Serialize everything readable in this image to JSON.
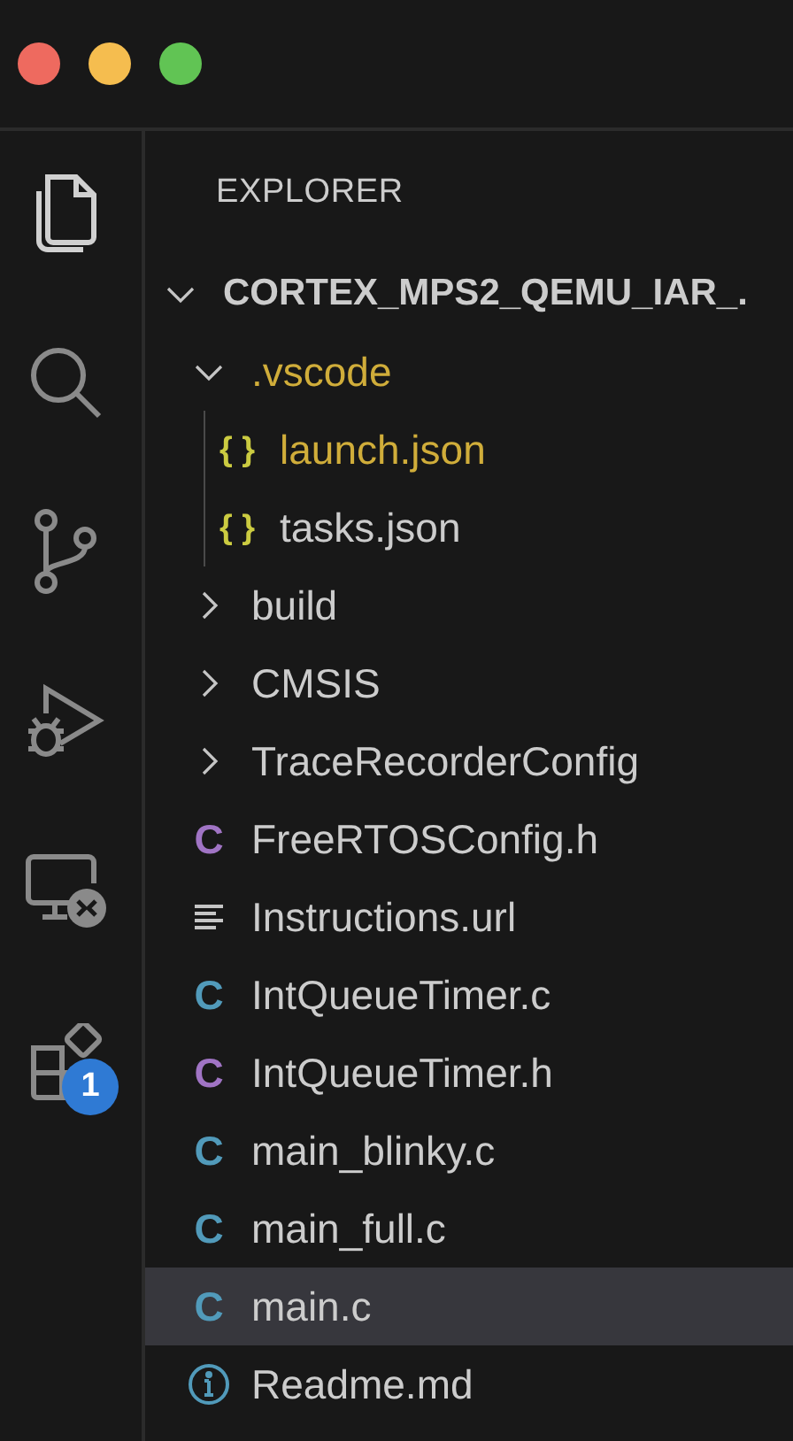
{
  "activity_bar": [
    {
      "kind": "explorer",
      "selected": true
    },
    {
      "kind": "search",
      "selected": false
    },
    {
      "kind": "source-control",
      "selected": false
    },
    {
      "kind": "run-debug",
      "selected": false
    },
    {
      "kind": "remote",
      "selected": false
    },
    {
      "kind": "extensions",
      "selected": false,
      "badge": "1"
    }
  ],
  "sidebar": {
    "title": "EXPLORER",
    "root": {
      "label": "CORTEX_MPS2_QEMU_IAR_.",
      "kind": "root",
      "expanded": true,
      "selected": false,
      "children": [
        {
          "label": ".vscode",
          "kind": "folder",
          "expanded": true,
          "modified": true,
          "selected": false,
          "children": [
            {
              "label": "launch.json",
              "kind": "json",
              "icon": "{ }",
              "modified": true,
              "selected": false
            },
            {
              "label": "tasks.json",
              "kind": "json",
              "icon": "{ }",
              "modified": false,
              "selected": false
            }
          ]
        },
        {
          "label": "build",
          "kind": "folder",
          "expanded": false,
          "modified": false,
          "selected": false
        },
        {
          "label": "CMSIS",
          "kind": "folder",
          "expanded": false,
          "modified": false,
          "selected": false
        },
        {
          "label": "TraceRecorderConfig",
          "kind": "folder",
          "expanded": false,
          "modified": false,
          "selected": false
        },
        {
          "label": "FreeRTOSConfig.h",
          "kind": "h",
          "icon": "C",
          "modified": false,
          "selected": false
        },
        {
          "label": "Instructions.url",
          "kind": "url",
          "modified": false,
          "selected": false
        },
        {
          "label": "IntQueueTimer.c",
          "kind": "c",
          "icon": "C",
          "modified": false,
          "selected": false
        },
        {
          "label": "IntQueueTimer.h",
          "kind": "h",
          "icon": "C",
          "modified": false,
          "selected": false
        },
        {
          "label": "main_blinky.c",
          "kind": "c",
          "icon": "C",
          "modified": false,
          "selected": false
        },
        {
          "label": "main_full.c",
          "kind": "c",
          "icon": "C",
          "modified": false,
          "selected": false
        },
        {
          "label": "main.c",
          "kind": "c",
          "icon": "C",
          "modified": false,
          "selected": true
        },
        {
          "label": "Readme.md",
          "kind": "info",
          "modified": false,
          "selected": false
        }
      ]
    }
  }
}
